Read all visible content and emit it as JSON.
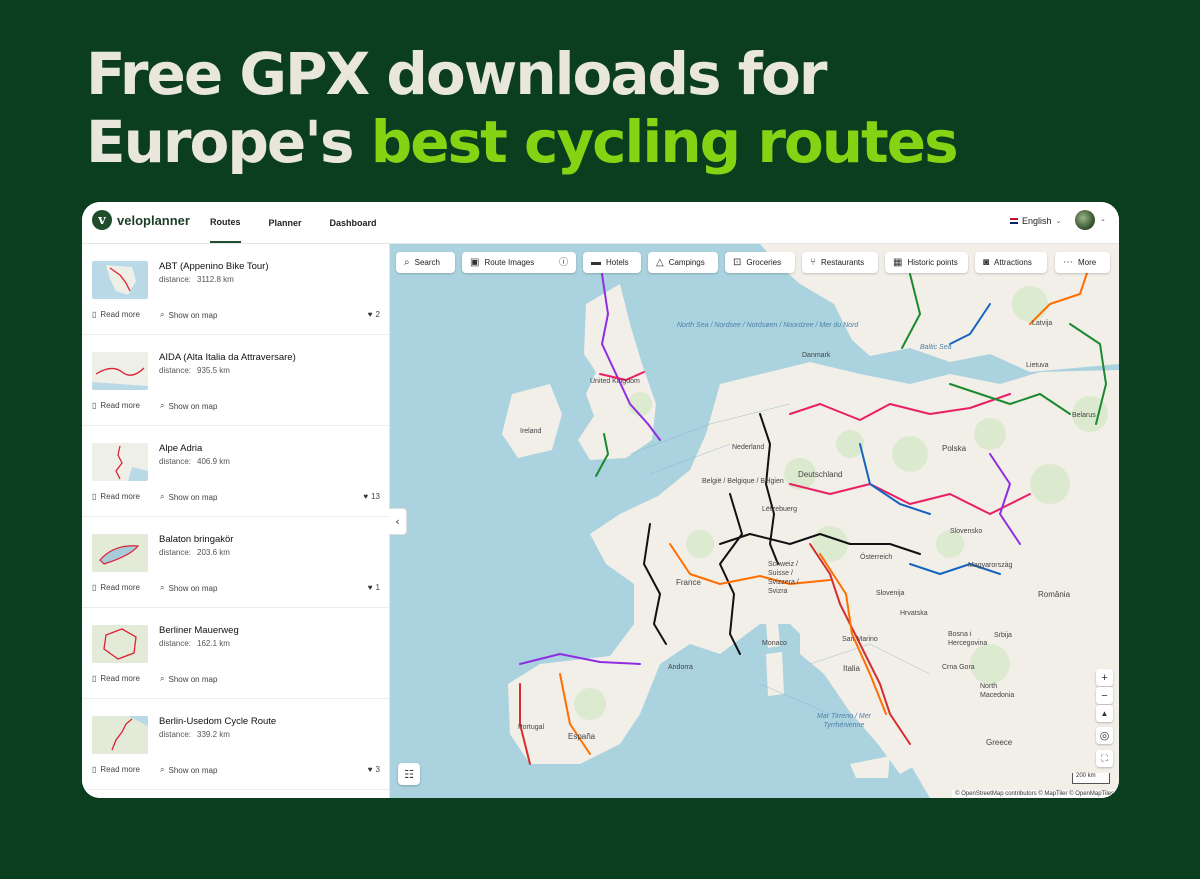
{
  "hero": {
    "line1": "Free GPX downloads for",
    "line2_plain": "Europe's ",
    "line2_highlight": "best cycling routes"
  },
  "colors": {
    "background": "#0b3d1f",
    "highlight": "#84d414",
    "headline": "#e9e6dc",
    "brand": "#1f4d2c"
  },
  "app": {
    "logo": "veloplanner",
    "logo_icon": "v-logo-icon",
    "tabs": [
      {
        "label": "Routes",
        "active": true
      },
      {
        "label": "Planner",
        "active": false
      },
      {
        "label": "Dashboard",
        "active": false
      }
    ],
    "language": "English"
  },
  "routes": [
    {
      "title": "ABT (Appenino Bike Tour)",
      "distance_label": "distance:",
      "distance": "3112.8 km",
      "read_more": "Read more",
      "show_on_map": "Show on map",
      "likes": "2"
    },
    {
      "title": "AIDA (Alta Italia da Attraversare)",
      "distance_label": "distance:",
      "distance": "935.5 km",
      "read_more": "Read more",
      "show_on_map": "Show on map",
      "likes": ""
    },
    {
      "title": "Alpe Adria",
      "distance_label": "distance:",
      "distance": "406.9 km",
      "read_more": "Read more",
      "show_on_map": "Show on map",
      "likes": "13"
    },
    {
      "title": "Balaton bringakör",
      "distance_label": "distance:",
      "distance": "203.6 km",
      "read_more": "Read more",
      "show_on_map": "Show on map",
      "likes": "1"
    },
    {
      "title": "Berliner Mauerweg",
      "distance_label": "distance:",
      "distance": "162.1 km",
      "read_more": "Read more",
      "show_on_map": "Show on map",
      "likes": ""
    },
    {
      "title": "Berlin-Usedom Cycle Route",
      "distance_label": "distance:",
      "distance": "339.2 km",
      "read_more": "Read more",
      "show_on_map": "Show on map",
      "likes": "3"
    }
  ],
  "map": {
    "chips": [
      "Search",
      "Route Images",
      "Hotels",
      "Campings",
      "Groceries",
      "Restaurants",
      "Historic points",
      "Attractions",
      "More"
    ],
    "labels": {
      "north_sea": "North Sea / Nordsee / Nordsøen / Noordzee / Mer du Nord",
      "baltic": "Baltic Sea",
      "uk": "United Kingdom",
      "ireland": "Ireland",
      "denmark": "Danmark",
      "netherlands": "Nederland",
      "belgium": "België / Belgique / Belgien",
      "luxembourg": "Lëtzebuerg",
      "germany": "Deutschland",
      "poland": "Polska",
      "france": "France",
      "switzerland": "Schweiz / Suisse / Svizzera / Svizra",
      "austria": "Österreich",
      "italy": "Italia",
      "spain": "España",
      "portugal": "Portugal",
      "slovenija": "Slovenija",
      "hrvatska": "Hrvatska",
      "bih": "Bosna i Hercegovina",
      "srbija": "Srbija",
      "romania": "România",
      "belarus": "Belarus",
      "lietuva": "Lietuva",
      "latvija": "Latvija",
      "slovensko": "Slovensko",
      "magyarorszag": "Magyarország",
      "monaco": "Monaco",
      "andorra": "Andorra",
      "san_marino": "San Marino",
      "tyrrhenian": "Mar Tirreno / Mer Tyrrhénienne",
      "macedonia": "North Macedonia",
      "greece": "Greece",
      "crna_gora": "Crna Gora"
    },
    "zoom_in": "+",
    "zoom_out": "−",
    "scale": "200 km",
    "attribution": "© OpenStreetMap contributors © MapTiler © OpenMapTiles"
  }
}
